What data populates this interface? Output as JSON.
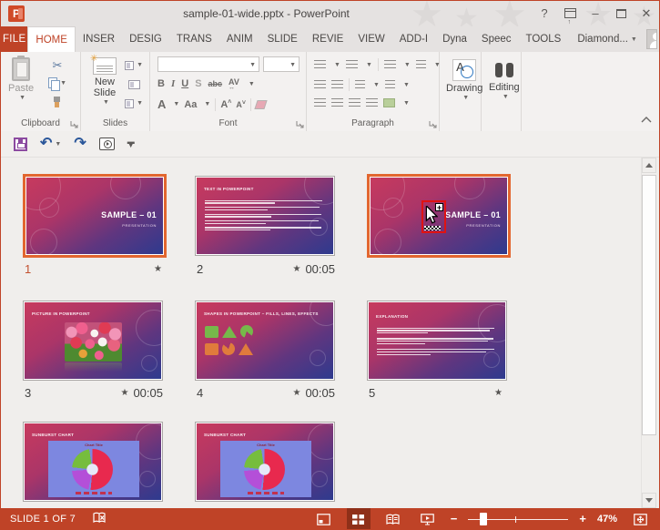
{
  "window": {
    "title": "sample-01-wide.pptx - PowerPoint",
    "help": "?"
  },
  "ribbon": {
    "file_tab": "FILE",
    "tabs": [
      {
        "label": "HOME",
        "active": true
      },
      {
        "label": "INSER"
      },
      {
        "label": "DESIG"
      },
      {
        "label": "TRANS"
      },
      {
        "label": "ANIM"
      },
      {
        "label": "SLIDE"
      },
      {
        "label": "REVIE"
      },
      {
        "label": "VIEW"
      },
      {
        "label": "ADD-I"
      },
      {
        "label": "Dyna"
      },
      {
        "label": "Speec"
      },
      {
        "label": "TOOLS"
      }
    ],
    "account_menu": "Diamond...",
    "clipboard": {
      "label": "Clipboard",
      "paste": "Paste"
    },
    "slides_group": {
      "label": "Slides",
      "new_slide": "New Slide"
    },
    "font_group": {
      "label": "Font",
      "bold": "B",
      "italic": "I",
      "underline": "U",
      "strike": "S",
      "abc": "abc",
      "av": "AV",
      "font_color": "A",
      "change_case": "Aa",
      "grow": "A",
      "shrink": "A"
    },
    "paragraph_group": {
      "label": "Paragraph"
    },
    "drawing_group": {
      "label": "Drawing",
      "icon_letter": "A"
    },
    "editing_group": {
      "label": "Editing"
    }
  },
  "slides": [
    {
      "number": "1",
      "star": "★",
      "time": "",
      "title": "SAMPLE – 01",
      "subtitle": "PRESENTATION"
    },
    {
      "number": "2",
      "star": "★",
      "time": "00:05",
      "title": "TEXT IN POWERPOINT"
    },
    {
      "number": "",
      "star": "",
      "time": "",
      "title": "SAMPLE – 01",
      "subtitle": "PRESENTATION"
    },
    {
      "number": "3",
      "star": "★",
      "time": "00:05",
      "title": "PICTURE IN POWERPOINT"
    },
    {
      "number": "4",
      "star": "★",
      "time": "00:05",
      "title": "SHAPES IN POWERPOINT – FILLS, LINES, EFFECTS"
    },
    {
      "number": "5",
      "star": "★",
      "time": "",
      "title": "EXPLANATION"
    },
    {
      "number": "",
      "star": "",
      "time": "",
      "title": "SUNBURST CHART",
      "chart_title": "Chart Title"
    },
    {
      "number": "",
      "star": "",
      "time": "",
      "title": "SUNBURST CHART",
      "chart_title": "Chart Title"
    }
  ],
  "status_bar": {
    "slide_info": "SLIDE 1 OF 7",
    "zoom_level": "47%",
    "zoom_out": "−",
    "zoom_in": "+"
  },
  "colors": {
    "accent_red": "#bf4327",
    "selection_orange": "#e2662f",
    "annotation_red": "#e01212"
  }
}
